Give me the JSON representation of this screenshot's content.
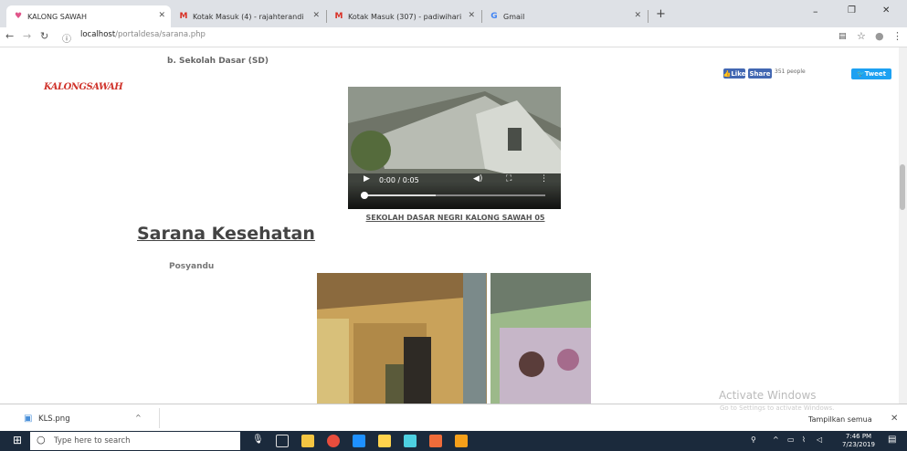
{
  "browser": {
    "tabs": [
      {
        "title": "KALONG SAWAH",
        "icon": "heart-icon",
        "active": true
      },
      {
        "title": "Kotak Masuk (4) - rajahterandi",
        "icon": "gmail-icon",
        "active": false
      },
      {
        "title": "Kotak Masuk (307) - padiwihari",
        "icon": "gmail-icon",
        "active": false
      },
      {
        "title": "Gmail",
        "icon": "google-icon",
        "active": false
      }
    ],
    "new_tab": "+",
    "url_host": "localhost",
    "url_path": "/portaldesa/sarana.php"
  },
  "page": {
    "logo_text": "KALONGSAWAH",
    "section_b": "b.   Sekolah Dasar (SD)",
    "video": {
      "time": "0:00 / 0:05",
      "caption": "SEKOLAH DASAR NEGRI KALONG SAWAH 05",
      "progress": 0.05
    },
    "heading": "Sarana Kesehatan",
    "sub": "Posyandu",
    "social": {
      "like": "Like",
      "share": "Share",
      "count": "351 people",
      "tweet": "Tweet"
    },
    "watermark_title": "Activate Windows",
    "watermark_sub": "Go to Settings to activate Windows."
  },
  "downloads": {
    "file": "KLS.png",
    "show_all": "Tampilkan semua"
  },
  "taskbar": {
    "search": "Type here to search",
    "time": "7:46 PM",
    "date": "7/23/2019"
  },
  "colors": {
    "accent_link": "#3a5f8a",
    "fb_blue": "#4267b2",
    "tw_blue": "#1da1f2",
    "taskbar": "#1b2a3c"
  }
}
